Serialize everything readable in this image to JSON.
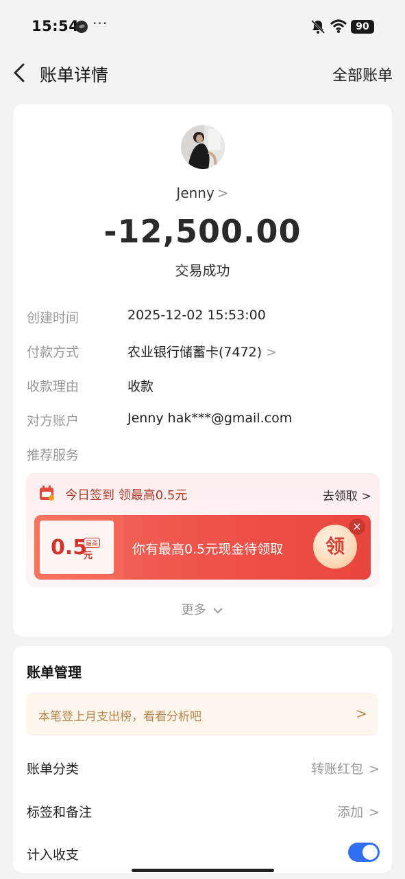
{
  "status_bar": {
    "time": "15:54",
    "more": "···",
    "battery": "90",
    "icons": [
      "mute-icon",
      "wifi-icon",
      "battery-icon"
    ]
  },
  "nav": {
    "title": "账单详情",
    "right_link": "全部账单",
    "back_icon": "chevron-left-icon"
  },
  "transaction": {
    "payee": "Jenny",
    "amount": "-12,500.00",
    "status": "交易成功"
  },
  "details": [
    {
      "label": "创建时间",
      "value": "2025-12-02 15:53:00"
    },
    {
      "label": "付款方式",
      "value": "农业银行储蓄卡(7472)"
    },
    {
      "label": "收款理由",
      "value": "收款"
    },
    {
      "label": "对方账户",
      "value": "Jenny hak***@gmail.com"
    },
    {
      "label": "推荐服务",
      "value": ""
    }
  ],
  "promo": {
    "title": "今日签到 领最高0.5元",
    "go_label": "去领取",
    "coupon_amount": "0.5",
    "coupon_unit": "元",
    "coupon_tag": "最高",
    "coupon_text": "你有最高0.5元现金待领取",
    "claim_label": "领",
    "close_label": "×"
  },
  "more_label": "更多",
  "management": {
    "title": "账单管理",
    "analysis_text": "本笔登上月支出榜，看看分析吧",
    "rows": [
      {
        "label": "账单分类",
        "value": "转账红包"
      },
      {
        "label": "标签和备注",
        "value": "添加"
      },
      {
        "label": "计入收支",
        "toggle": true
      }
    ]
  },
  "colors": {
    "accent_blue": "#2f6ff0",
    "promo_red": "#ee5248",
    "analysis_bg": "#fdf6ec",
    "analysis_text": "#b8874f"
  }
}
